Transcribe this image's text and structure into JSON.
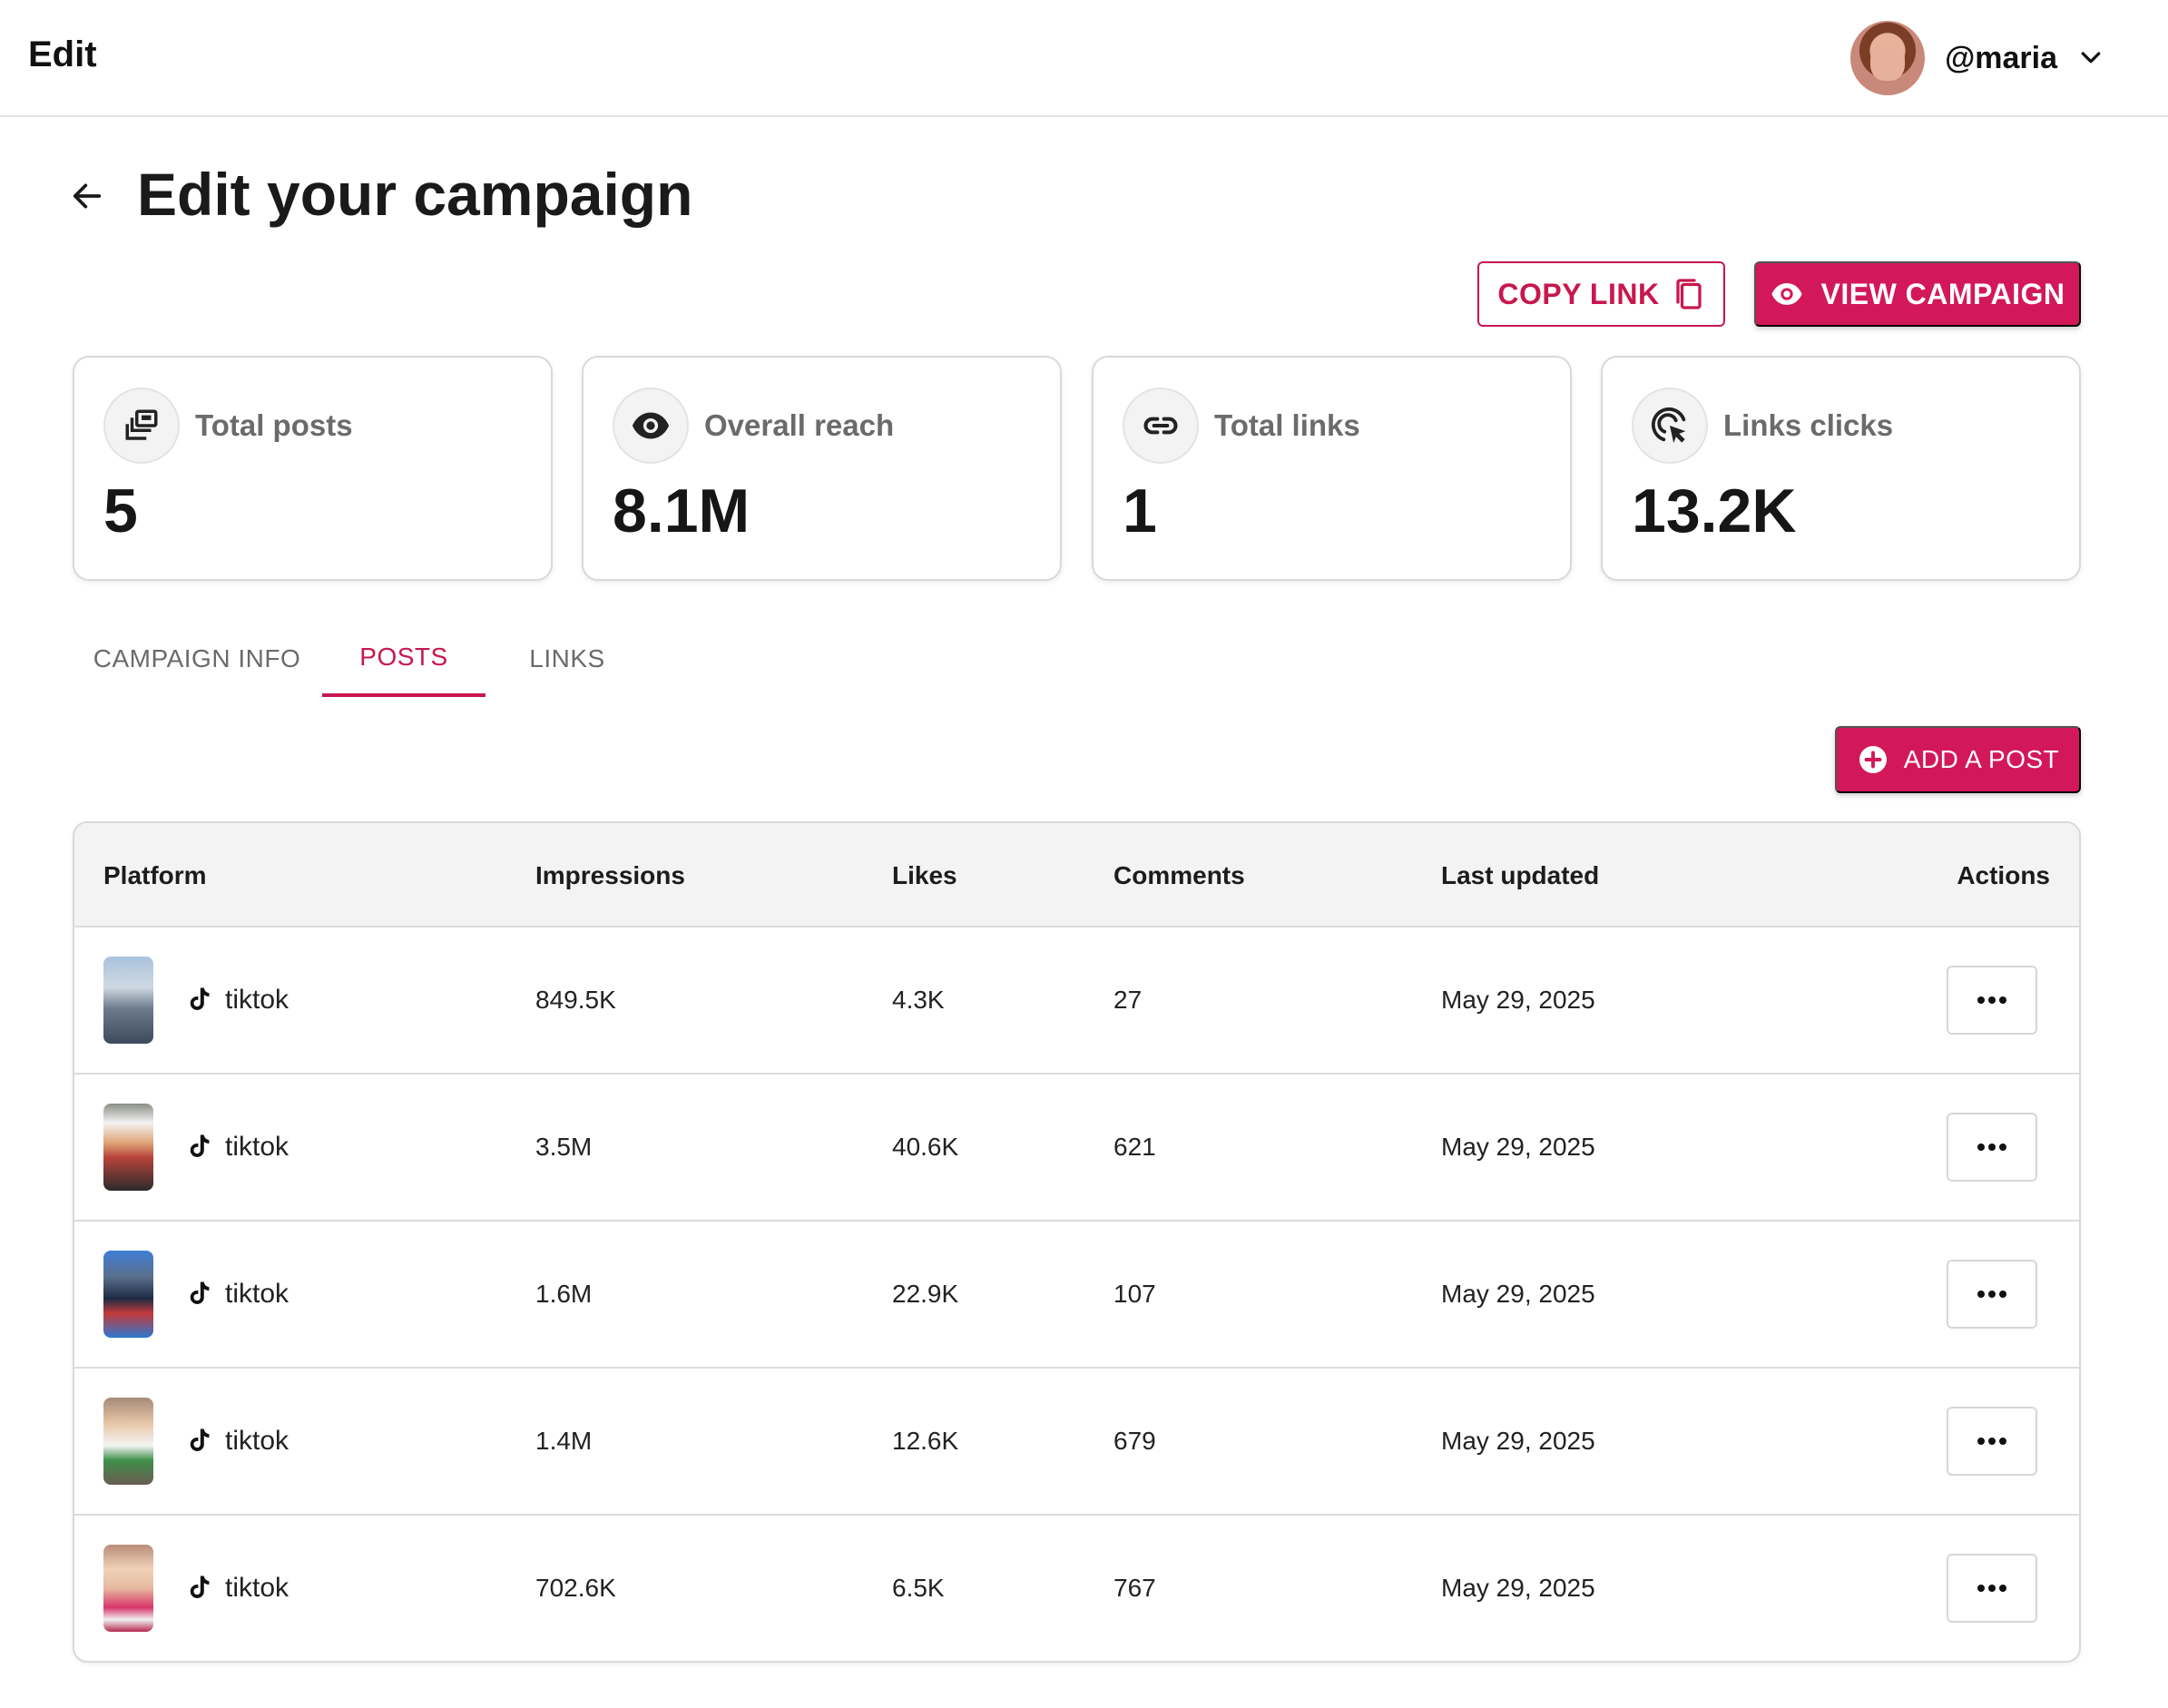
{
  "topbar": {
    "title": "Edit",
    "username": "@maria"
  },
  "header": {
    "title": "Edit your campaign"
  },
  "actions": {
    "copy_link": "COPY LINK",
    "view_campaign": "VIEW CAMPAIGN",
    "add_post": "ADD A POST"
  },
  "stats": [
    {
      "label": "Total posts",
      "value": "5",
      "icon": "posts-icon"
    },
    {
      "label": "Overall reach",
      "value": "8.1M",
      "icon": "eye-icon"
    },
    {
      "label": "Total links",
      "value": "1",
      "icon": "link-icon"
    },
    {
      "label": "Links clicks",
      "value": "13.2K",
      "icon": "click-icon"
    }
  ],
  "tabs": [
    {
      "label": "CAMPAIGN INFO",
      "active": false
    },
    {
      "label": "POSTS",
      "active": true
    },
    {
      "label": "LINKS",
      "active": false
    }
  ],
  "table": {
    "columns": [
      "Platform",
      "Impressions",
      "Likes",
      "Comments",
      "Last updated",
      "Actions"
    ],
    "rows": [
      {
        "platform": "tiktok",
        "impressions": "849.5K",
        "likes": "4.3K",
        "comments": "27",
        "last_updated": "May 29, 2025"
      },
      {
        "platform": "tiktok",
        "impressions": "3.5M",
        "likes": "40.6K",
        "comments": "621",
        "last_updated": "May 29, 2025"
      },
      {
        "platform": "tiktok",
        "impressions": "1.6M",
        "likes": "22.9K",
        "comments": "107",
        "last_updated": "May 29, 2025"
      },
      {
        "platform": "tiktok",
        "impressions": "1.4M",
        "likes": "12.6K",
        "comments": "679",
        "last_updated": "May 29, 2025"
      },
      {
        "platform": "tiktok",
        "impressions": "702.6K",
        "likes": "6.5K",
        "comments": "767",
        "last_updated": "May 29, 2025"
      }
    ]
  },
  "colors": {
    "accent": "#d3185a",
    "accent_text": "#c8174e",
    "border": "#d9d9d9",
    "header_bg": "#f3f3f3"
  }
}
